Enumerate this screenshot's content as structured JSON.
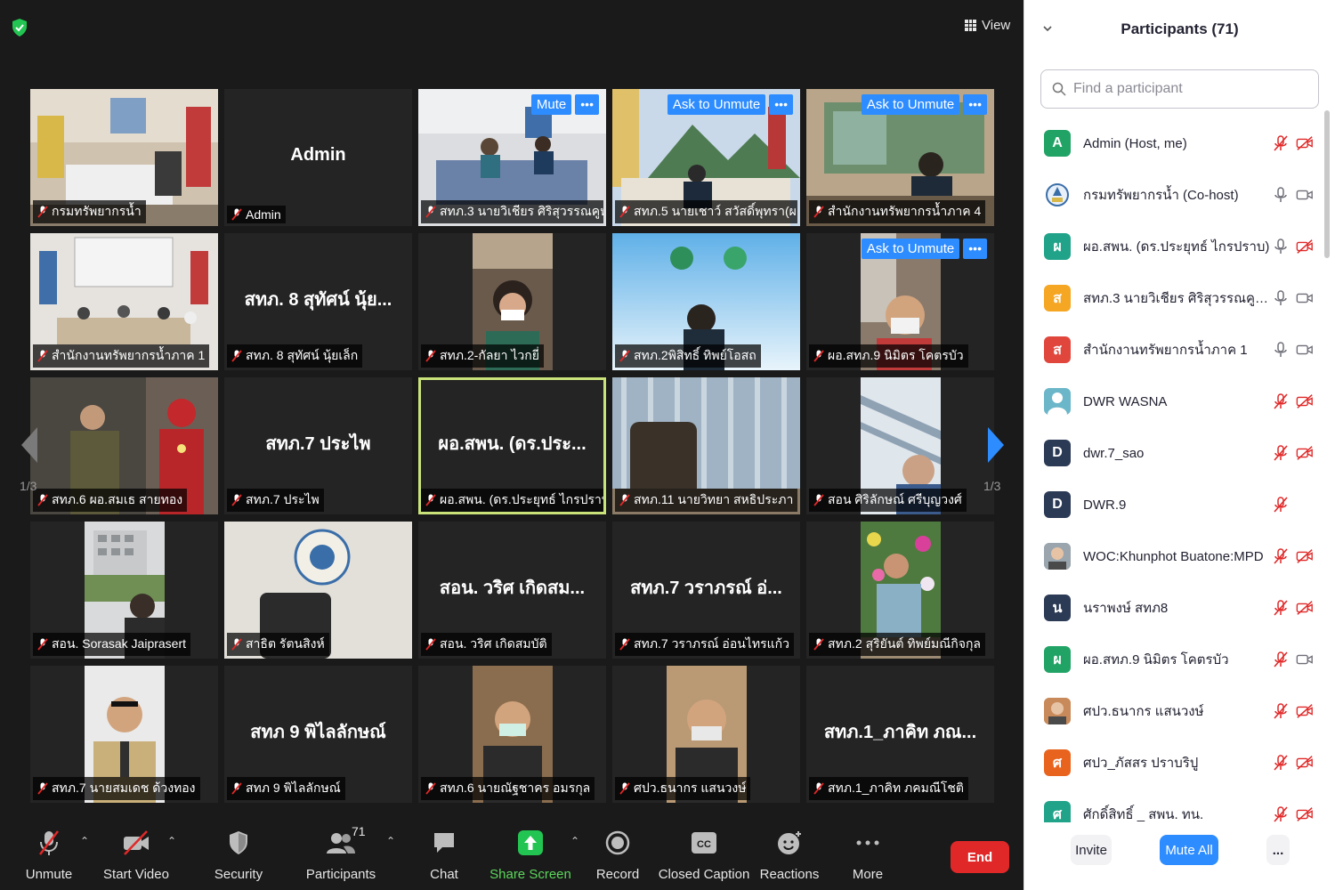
{
  "meeting": {
    "view_label": "View",
    "page_left": "1/3",
    "page_right": "1/3",
    "tiles": [
      {
        "name": "กรมทรัพยากรน้ำ",
        "type": "video",
        "scene": "office"
      },
      {
        "name": "Admin",
        "center": "Admin",
        "type": "name"
      },
      {
        "name": "สทภ.3 นายวิเชียร ศิริสุวรรณคูหา (...",
        "type": "video",
        "scene": "meeting",
        "ctrl": "Mute"
      },
      {
        "name": "สทภ.5 นายเชาว์ สวัสดิ์พุทรา(ผ...",
        "type": "video",
        "scene": "mountain",
        "ctrl": "Ask to Unmute"
      },
      {
        "name": "สำนักงานทรัพยากรน้ำภาค 4",
        "type": "video",
        "scene": "office2",
        "ctrl": "Ask to Unmute"
      },
      {
        "name": "สำนักงานทรัพยากรน้ำภาค 1",
        "type": "video",
        "scene": "conference"
      },
      {
        "name": "สทภ. 8 สุทัศน์ นุ้ยเล็ก",
        "center": "สทภ. 8 สุทัศน์ นุ้ย...",
        "type": "name"
      },
      {
        "name": "สทภ.2-กัลยา ไวกยี่",
        "type": "portrait",
        "scene": "woman"
      },
      {
        "name": "สทภ.2พิสิทธิ์ ทิพย์โอสถ",
        "type": "video",
        "scene": "sky"
      },
      {
        "name": "ผอ.สทภ.9 นิมิตร โคตรบัว",
        "type": "portrait",
        "scene": "man",
        "ctrl": "Ask to Unmute"
      },
      {
        "name": "สทภ.6 ผอ.สมเธ สายทอง",
        "type": "video",
        "scene": "ironman"
      },
      {
        "name": "สทภ.7 ประไพ",
        "center": "สทภ.7 ประไพ",
        "type": "name"
      },
      {
        "name": "ผอ.สพน. (ดร.ประยุทธ์ ไกรปราบ)",
        "center": "ผอ.สพน. (ดร.ประ...",
        "type": "name",
        "active": true
      },
      {
        "name": "สทภ.11 นายวิทยา สหธิประภา",
        "type": "video",
        "scene": "chair"
      },
      {
        "name": "สอน ศิริลักษณ์ ศรีบุญวงศ์",
        "type": "portrait",
        "scene": "selfie"
      },
      {
        "name": "สอน. Sorasak Jaiprasert",
        "type": "portrait",
        "scene": "building"
      },
      {
        "name": "สาธิต รัตนสิงห์",
        "type": "video",
        "scene": "emblem"
      },
      {
        "name": "สอน. วริศ เกิดสมบัติ",
        "center": "สอน. วริศ เกิดสม...",
        "type": "name"
      },
      {
        "name": "สทภ.7 วราภรณ์ อ่อนไทรแก้ว",
        "center": "สทภ.7 วราภรณ์ อ่...",
        "type": "name"
      },
      {
        "name": "สทภ.2 สุริยันต์ ทิพย์มณีกิจกุล",
        "type": "portrait",
        "scene": "flowers"
      },
      {
        "name": "สทภ.7 นายสมเดช ด้วงทอง",
        "type": "portrait",
        "scene": "uniform"
      },
      {
        "name": "สทภ 9 พิไลลักษณ์",
        "center": "สทภ 9 พิไลลักษณ์",
        "type": "name"
      },
      {
        "name": "สทภ.6 นายณัฐชาคร อมรกุล",
        "type": "portrait",
        "scene": "mask"
      },
      {
        "name": "ศปว.ธนากร แสนวงษ์",
        "type": "portrait",
        "scene": "mask2"
      },
      {
        "name": "สทภ.1_ภาคิท ภคมณีโชติ",
        "center": "สทภ.1_ภาคิท ภณ...",
        "type": "name"
      }
    ]
  },
  "toolbar": {
    "unmute": "Unmute",
    "start_video": "Start Video",
    "security": "Security",
    "participants": "Participants",
    "participants_count": "71",
    "chat": "Chat",
    "share_screen": "Share Screen",
    "record": "Record",
    "closed_caption": "Closed Caption",
    "reactions": "Reactions",
    "more": "More",
    "end": "End"
  },
  "panel": {
    "title": "Participants (71)",
    "search_placeholder": "Find a participant",
    "participants": [
      {
        "initial": "A",
        "color": "#21a366",
        "name": "Admin (Host, me)",
        "mic": "off",
        "cam": "off"
      },
      {
        "initial": "",
        "color": "#ffffff",
        "name": "กรมทรัพยากรน้ำ (Co-host)",
        "mic": "on",
        "cam": "on",
        "logo": true
      },
      {
        "initial": "ผ",
        "color": "#21a38a",
        "name": "ผอ.สพน. (ดร.ประยุทธ์ ไกรปราบ)",
        "mic": "on",
        "cam": "off"
      },
      {
        "initial": "ส",
        "color": "#f5a623",
        "name": "สทภ.3 นายวิเชียร ศิริสุวรรณคูหา (ผ...",
        "mic": "on",
        "cam": "on"
      },
      {
        "initial": "ส",
        "color": "#e0463c",
        "name": "สำนักงานทรัพยากรน้ำภาค 1",
        "mic": "on",
        "cam": "on"
      },
      {
        "initial": "",
        "color": "#6bb6c9",
        "name": "DWR WASNA",
        "mic": "off",
        "cam": "off",
        "person": true
      },
      {
        "initial": "D",
        "color": "#2b3a55",
        "name": "dwr.7_sao",
        "mic": "off",
        "cam": "off"
      },
      {
        "initial": "D",
        "color": "#2b3a55",
        "name": "DWR.9",
        "mic": "off",
        "cam": "none"
      },
      {
        "initial": "",
        "color": "#9aa5ad",
        "name": "WOC:Khunphot Buatone:MPD",
        "mic": "off",
        "cam": "off",
        "photo": true
      },
      {
        "initial": "น",
        "color": "#2b3a55",
        "name": "นราพงษ์ สทภ8",
        "mic": "off",
        "cam": "off"
      },
      {
        "initial": "ผ",
        "color": "#21a366",
        "name": "ผอ.สทภ.9 นิมิตร โคตรบัว",
        "mic": "off",
        "cam": "on"
      },
      {
        "initial": "",
        "color": "#c88a5a",
        "name": "ศปว.ธนากร แสนวงษ์",
        "mic": "off",
        "cam": "off",
        "photo": true
      },
      {
        "initial": "ศ",
        "color": "#e8641e",
        "name": "ศปว_ภัสสร ปราบริปู",
        "mic": "off",
        "cam": "off"
      },
      {
        "initial": "ศ",
        "color": "#21a38a",
        "name": "ศักดิ์สิทธิ์ _ สพน. ทน.",
        "mic": "off",
        "cam": "off"
      }
    ],
    "invite": "Invite",
    "mute_all": "Mute All",
    "more": "..."
  }
}
